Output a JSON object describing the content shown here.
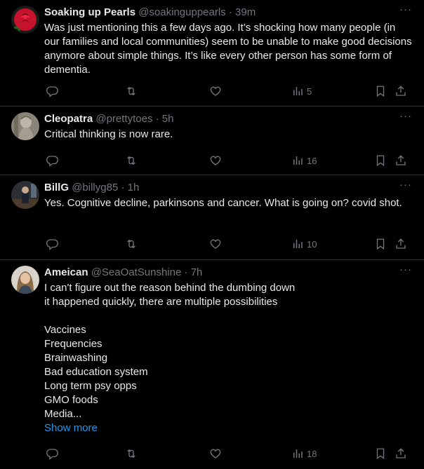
{
  "tweets": [
    {
      "name": "Soaking up Pearls",
      "handle": "@soakinguppearls",
      "dot": "·",
      "time": "39m",
      "text": "Was just mentioning this a few days ago. It’s shocking how many people (in our families and local communities) seem to be unable to make good decisions anymore about simple things. It’s like every other person has some form of dementia.",
      "views": "5",
      "avatar": "rose-avatar"
    },
    {
      "name": "Cleopatra",
      "handle": "@prettytoes",
      "dot": "·",
      "time": "5h",
      "text": "Critical thinking is now rare.",
      "views": "16",
      "avatar": "statue-avatar"
    },
    {
      "name": "BillG",
      "handle": "@billyg85",
      "dot": "·",
      "time": "1h",
      "text": "Yes. Cognitive decline, parkinsons and cancer. What is going on?  covid shot.",
      "views": "10",
      "avatar": "person-avatar"
    },
    {
      "name": "Ameican",
      "handle": "@SeaOatSunshine",
      "dot": "·",
      "time": "7h",
      "lines": [
        "I can't figure out the reason behind the dumbing down",
        "it happened quickly, there are multiple possibilities",
        "",
        "Vaccines",
        "Frequencies",
        "Brainwashing",
        "Bad education system",
        "Long term psy opps",
        "GMO foods",
        "Media..."
      ],
      "show_more": "Show more",
      "views": "18",
      "avatar": "woman-avatar"
    }
  ],
  "more_label": "···",
  "icons": {
    "reply": "reply-icon",
    "retweet": "retweet-icon",
    "like": "heart-icon",
    "views": "views-icon",
    "bookmark": "bookmark-icon",
    "share": "share-icon"
  },
  "colors": {
    "background": "#000000",
    "text": "#e7e9ea",
    "muted": "#71767b",
    "link": "#1d9bf0",
    "divider": "#2f3336"
  }
}
